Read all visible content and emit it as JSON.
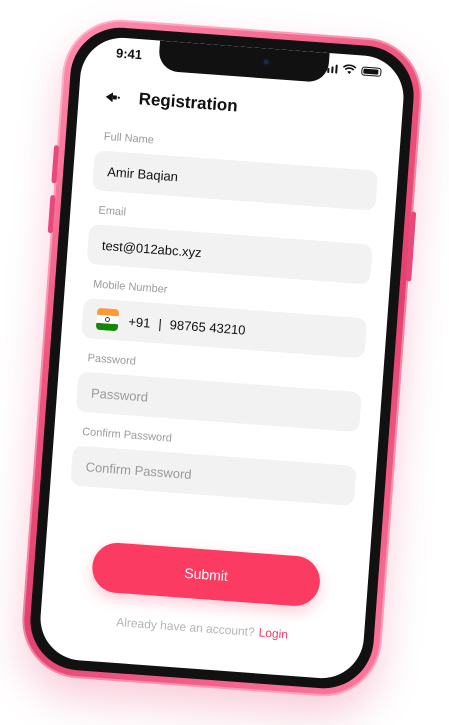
{
  "status_bar": {
    "time": "9:41"
  },
  "header": {
    "title": "Registration",
    "back_icon": "back-arrow-icon"
  },
  "form": {
    "full_name": {
      "label": "Full Name",
      "value": "Amir Baqian"
    },
    "email": {
      "label": "Email",
      "value": "test@012abc.xyz"
    },
    "mobile": {
      "label": "Mobile Number",
      "country_code": "+91",
      "separator": "|",
      "number": "98765 43210",
      "flag_icon": "india-flag-icon"
    },
    "password": {
      "label": "Password",
      "placeholder": "Password"
    },
    "confirm_password": {
      "label": "Confirm Password",
      "placeholder": "Confirm Password"
    }
  },
  "actions": {
    "submit_label": "Submit"
  },
  "footer": {
    "prompt": "Already have an account?",
    "login_label": "Login"
  },
  "colors": {
    "accent": "#fb3b62",
    "phone_frame": "#f0557f",
    "input_bg": "#f2f2f2",
    "label": "#9a9a9a"
  }
}
